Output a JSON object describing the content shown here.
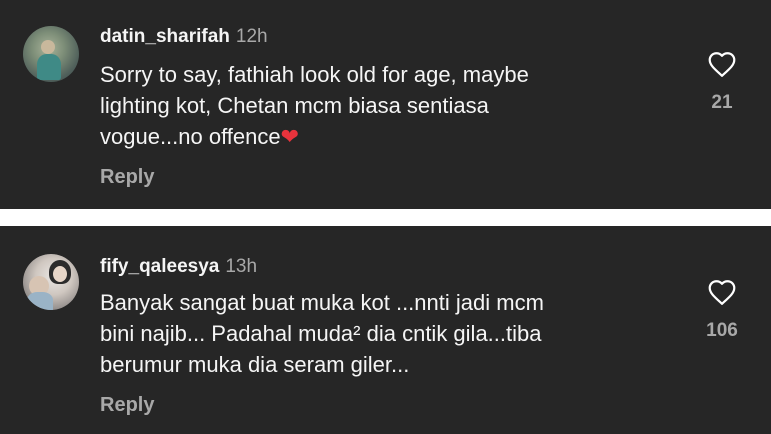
{
  "comments": [
    {
      "username": "datin_sharifah",
      "time": "12h",
      "lines": [
        "Sorry to say, fathiah look old for age, maybe",
        "lighting kot, Chetan mcm biasa sentiasa",
        "vogue...no offence"
      ],
      "emoji": "❤",
      "reply_label": "Reply",
      "like_count": "21",
      "like_icon": "heart-outline-icon"
    },
    {
      "username": "fify_qaleesya",
      "time": "13h",
      "lines": [
        "Banyak sangat buat muka kot ...nnti jadi mcm",
        "bini najib... Padahal muda² dia cntik gila...tiba",
        "berumur muka dia seram giler..."
      ],
      "reply_label": "Reply",
      "like_count": "106",
      "like_icon": "heart-outline-icon"
    }
  ],
  "colors": {
    "card_background": "#262626",
    "divider": "#ffffff",
    "primary_text": "#f5f5f5",
    "secondary_text": "#a8a8a8",
    "emoji_heart": "#e8333c"
  }
}
